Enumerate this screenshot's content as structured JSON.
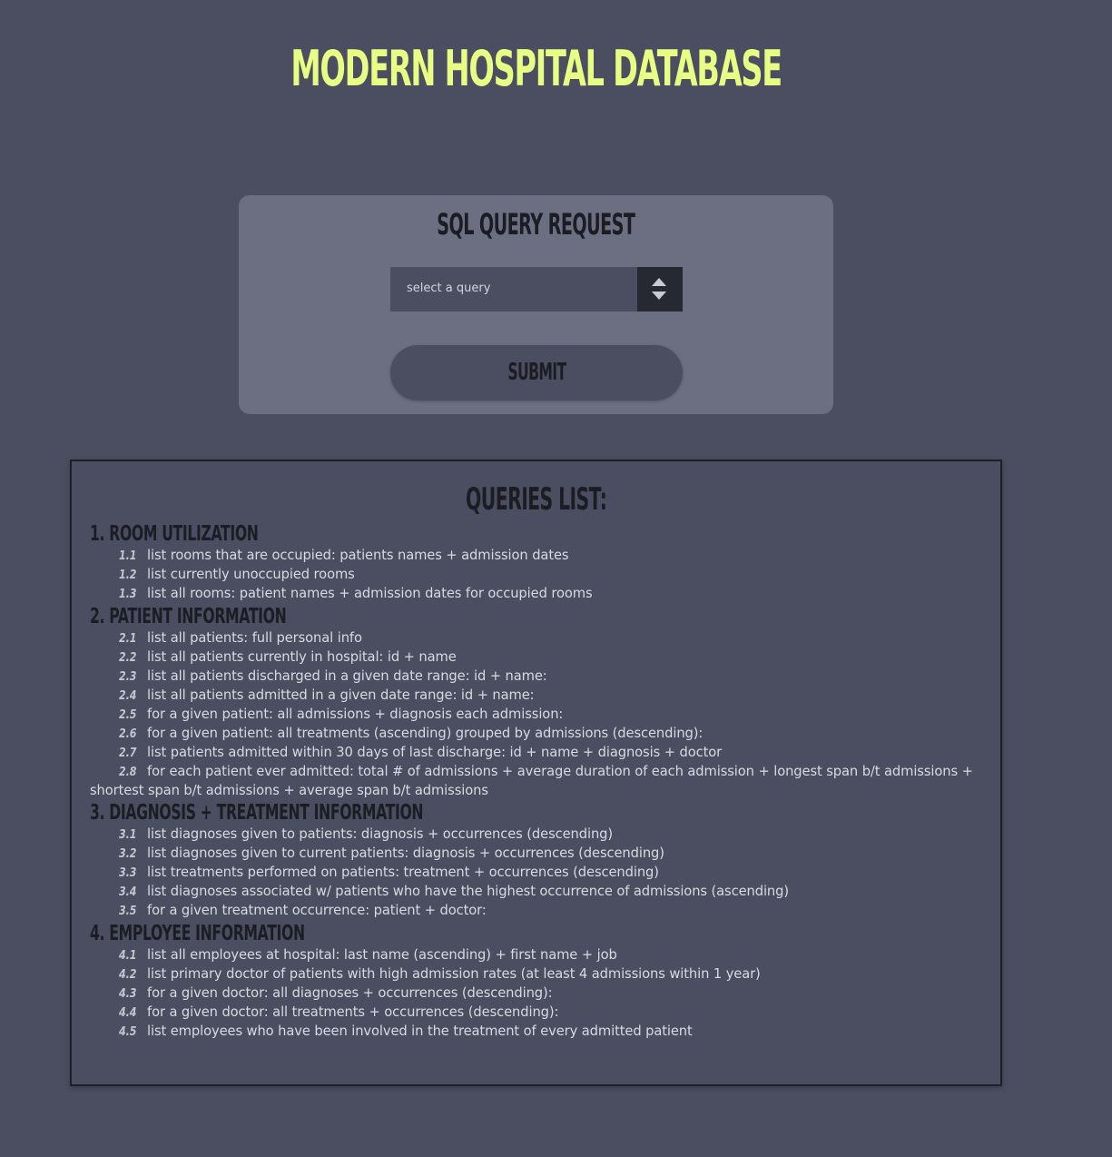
{
  "header": {
    "title": "MODERN HOSPITAL DATABASE"
  },
  "form": {
    "title": "SQL QUERY REQUEST",
    "select_value": "select a query",
    "submit_label": "SUBMIT"
  },
  "queries": {
    "title": "QUERIES LIST:",
    "sections": [
      {
        "title": "1. ROOM UTILIZATION",
        "items": [
          {
            "num": "1.1",
            "text": "list rooms that are occupied: patients names + admission dates"
          },
          {
            "num": "1.2",
            "text": "list currently unoccupied rooms"
          },
          {
            "num": "1.3",
            "text": "list all rooms: patient names + admission dates for occupied rooms"
          }
        ]
      },
      {
        "title": "2. PATIENT INFORMATION",
        "items": [
          {
            "num": "2.1",
            "text": "list all patients: full personal info"
          },
          {
            "num": "2.2",
            "text": "list all patients currently in hospital: id + name"
          },
          {
            "num": "2.3",
            "text": "list all patients discharged in a given date range: id + name:"
          },
          {
            "num": "2.4",
            "text": "list all patients admitted in a given date range: id + name:"
          },
          {
            "num": "2.5",
            "text": "for a given patient: all admissions + diagnosis each admission:"
          },
          {
            "num": "2.6",
            "text": "for a given patient: all treatments (ascending) grouped by admissions (descending):"
          },
          {
            "num": "2.7",
            "text": "list patients admitted within 30 days of last discharge: id + name + diagnosis + doctor"
          },
          {
            "num": "2.8",
            "text": "for each patient ever admitted: total # of admissions + average duration of each admission + longest span b/t admissions + shortest span b/t admissions + average span b/t admissions"
          }
        ]
      },
      {
        "title": "3. DIAGNOSIS + TREATMENT INFORMATION",
        "items": [
          {
            "num": "3.1",
            "text": "list diagnoses given to patients: diagnosis + occurrences (descending)"
          },
          {
            "num": "3.2",
            "text": "list diagnoses given to current patients: diagnosis + occurrences (descending)"
          },
          {
            "num": "3.3",
            "text": "list treatments performed on patients: treatment + occurrences (descending)"
          },
          {
            "num": "3.4",
            "text": "list diagnoses associated w/ patients who have the highest occurrence of admissions (ascending)"
          },
          {
            "num": "3.5",
            "text": "for a given treatment occurrence: patient + doctor:"
          }
        ]
      },
      {
        "title": "4. EMPLOYEE INFORMATION",
        "items": [
          {
            "num": "4.1",
            "text": "list all employees at hospital: last name (ascending) + first name + job"
          },
          {
            "num": "4.2",
            "text": "list primary doctor of patients with high admission rates (at least 4 admissions within 1 year)"
          },
          {
            "num": "4.3",
            "text": "for a given doctor: all diagnoses + occurrences (descending):"
          },
          {
            "num": "4.4",
            "text": "for a given doctor: all treatments + occurrences (descending):"
          },
          {
            "num": "4.5",
            "text": "list employees who have been involved in the treatment of every admitted patient"
          }
        ]
      }
    ]
  }
}
